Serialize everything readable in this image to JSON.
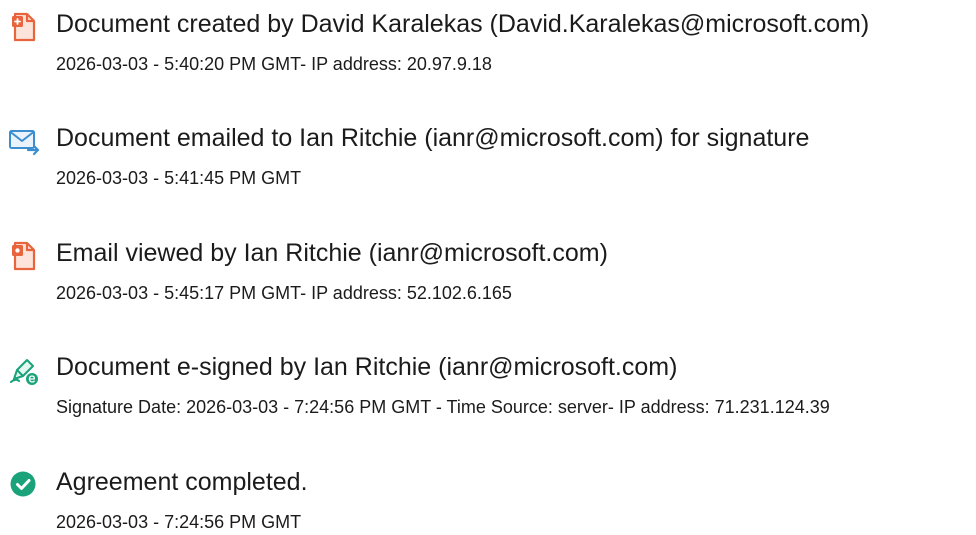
{
  "events": [
    {
      "icon": "document-created-icon",
      "title": "Document created by David Karalekas (David.Karalekas@microsoft.com)",
      "meta": "2026-03-03 - 5:40:20 PM GMT- IP address: 20.97.9.18"
    },
    {
      "icon": "email-sent-icon",
      "title": "Document emailed to Ian Ritchie (ianr@microsoft.com) for signature",
      "meta": "2026-03-03 - 5:41:45 PM GMT"
    },
    {
      "icon": "document-viewed-icon",
      "title": "Email viewed by Ian Ritchie (ianr@microsoft.com)",
      "meta": "2026-03-03 - 5:45:17 PM GMT- IP address: 52.102.6.165"
    },
    {
      "icon": "esign-pen-icon",
      "title": "Document e-signed by Ian Ritchie (ianr@microsoft.com)",
      "meta": "Signature Date: 2026-03-03 - 7:24:56 PM GMT - Time Source: server- IP address: 71.231.124.39"
    },
    {
      "icon": "checkmark-circle-icon",
      "title": "Agreement completed.",
      "meta": "2026-03-03 - 7:24:56 PM GMT"
    }
  ],
  "colors": {
    "document_icon": "#e8643c",
    "email_icon": "#3b8ed0",
    "esign_icon": "#1aa37a",
    "complete_icon": "#1aa37a",
    "text": "#1b1b1b"
  }
}
